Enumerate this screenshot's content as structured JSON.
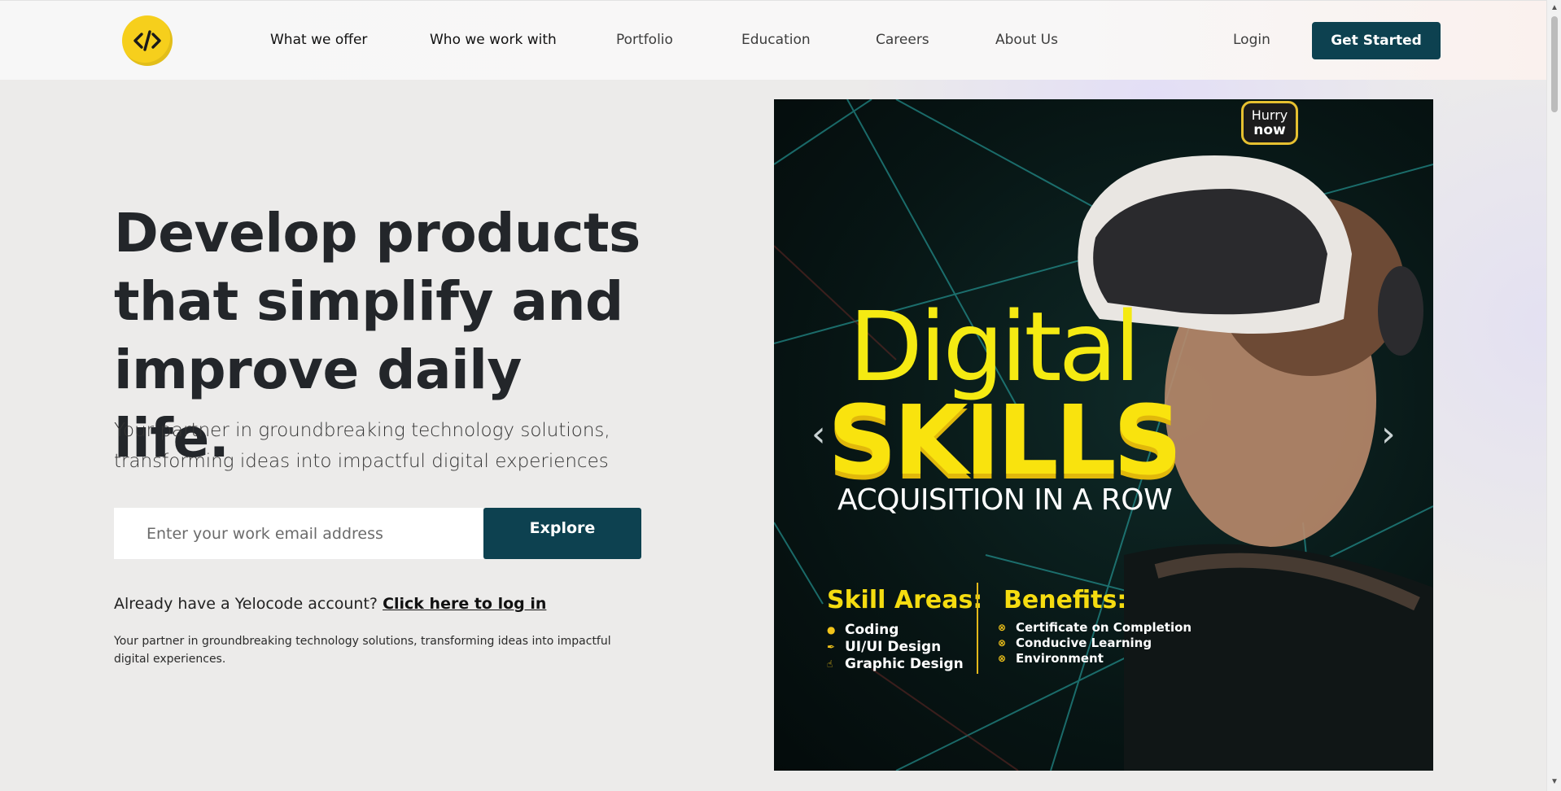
{
  "header": {
    "logo_icon": "code-brackets-icon",
    "nav": [
      "What we offer",
      "Who we work with",
      "Portfolio",
      "Education",
      "Careers",
      "About Us"
    ],
    "login_label": "Login",
    "cta_label": "Get Started"
  },
  "hero": {
    "title": "Develop products that simplify and improve daily life.",
    "subtitle": "Your partner in groundbreaking technology solutions, transforming ideas into impactful digital experiences",
    "email_placeholder": "Enter your work email address",
    "explore_label": "Explore",
    "account_prompt": "Already have a Yelocode account?",
    "login_link": "Click here to log in",
    "small_text": "Your partner in groundbreaking technology solutions, transforming ideas into impactful digital experiences."
  },
  "banner": {
    "badge_line1": "Hurry",
    "badge_line2": "now",
    "headline1": "Digital",
    "headline2": "SKILLS",
    "tagline": "ACQUISITION IN A ROW",
    "areas_title": "Skill Areas:",
    "areas": [
      "Coding",
      "UI/UI Design",
      "Graphic Design"
    ],
    "benefits_title": "Benefits:",
    "benefits": [
      "Certificate on Completion",
      "Conducive Learning",
      "Environment"
    ],
    "prev_icon": "chevron-left-icon",
    "next_icon": "chevron-right-icon"
  },
  "colors": {
    "primary": "#0d4150",
    "accent_yellow": "#f6cf1c",
    "text_dark": "#23262a"
  }
}
